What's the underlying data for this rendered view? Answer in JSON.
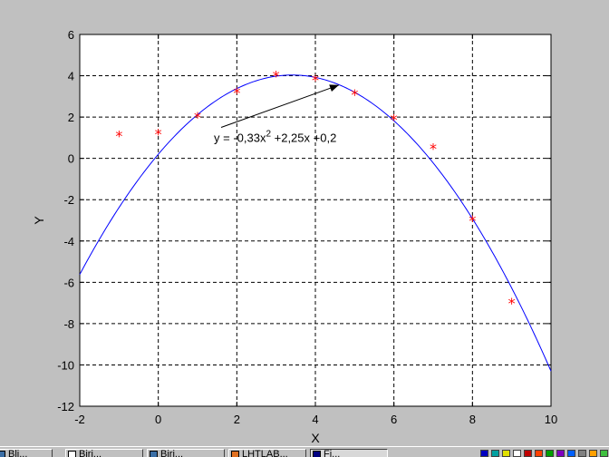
{
  "chart_data": {
    "type": "scatter",
    "xlabel": "X",
    "ylabel": "Y",
    "xlim": [
      -2,
      10
    ],
    "ylim": [
      -12,
      6
    ],
    "xticks": [
      -2,
      0,
      2,
      4,
      6,
      8,
      10
    ],
    "yticks": [
      -12,
      -10,
      -8,
      -6,
      -4,
      -2,
      0,
      2,
      4,
      6
    ],
    "grid": true,
    "series": [
      {
        "marker": "*",
        "color": "#ff0000",
        "points": [
          {
            "x": -1,
            "y": 1.1
          },
          {
            "x": 0,
            "y": 1.2
          },
          {
            "x": 1,
            "y": 2.0
          },
          {
            "x": 2,
            "y": 3.2
          },
          {
            "x": 3,
            "y": 4.0
          },
          {
            "x": 4,
            "y": 3.8
          },
          {
            "x": 5,
            "y": 3.1
          },
          {
            "x": 6,
            "y": 1.9
          },
          {
            "x": 7,
            "y": 0.5
          },
          {
            "x": 8,
            "y": -3.0
          },
          {
            "x": 9,
            "y": -7.0
          }
        ]
      }
    ],
    "fit": {
      "color": "#0000ff",
      "coefficients": [
        -0.33,
        2.25,
        0.2
      ],
      "x_range": [
        -2,
        10
      ]
    },
    "annotation": {
      "text_main": "y = -0,33x",
      "text_sup": "2",
      "text_rest": " +2,25x +0,2",
      "anchor": {
        "x": 1.6,
        "y": 1.5
      },
      "arrow_to": {
        "x": 4.6,
        "y": 3.55
      }
    }
  },
  "taskbar": {
    "items": [
      {
        "label": "Bli..."
      },
      {
        "label": "Biri..."
      },
      {
        "label": "Biri..."
      },
      {
        "label": "LHTLAB..."
      },
      {
        "label": "Fi..."
      }
    ]
  }
}
